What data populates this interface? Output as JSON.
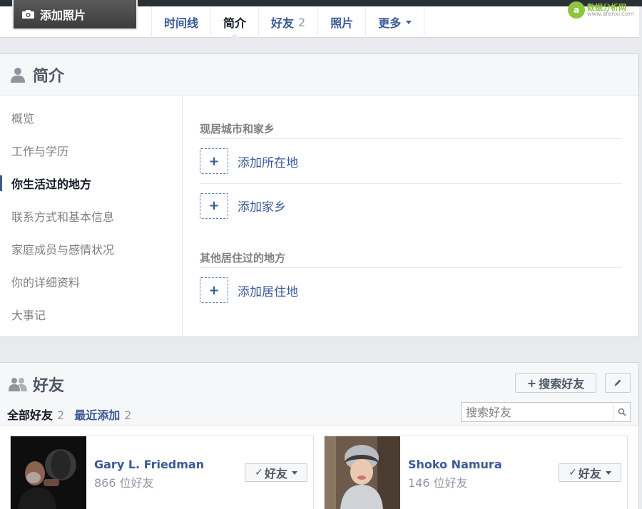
{
  "cover": {
    "add_photo_label": "添加照片"
  },
  "tabs": [
    {
      "label": "时间线",
      "count": ""
    },
    {
      "label": "简介",
      "count": ""
    },
    {
      "label": "好友",
      "count": "2"
    },
    {
      "label": "照片",
      "count": ""
    },
    {
      "label": "更多",
      "count": ""
    }
  ],
  "watermark": {
    "name": "数据分析网",
    "url": "www.afenxi.com"
  },
  "about": {
    "title": "简介",
    "nav": [
      {
        "label": "概览"
      },
      {
        "label": "工作与学历"
      },
      {
        "label": "你生活过的地方"
      },
      {
        "label": "联系方式和基本信息"
      },
      {
        "label": "家庭成员与感情状况"
      },
      {
        "label": "你的详细资料"
      },
      {
        "label": "大事记"
      }
    ],
    "selected_nav": "你生活过的地方",
    "sections": [
      {
        "title": "现居城市和家乡",
        "items": [
          "添加所在地",
          "添加家乡"
        ]
      },
      {
        "title": "其他居住过的地方",
        "items": [
          "添加居住地"
        ]
      }
    ]
  },
  "friends": {
    "title": "好友",
    "find_button": "搜索好友",
    "tabs": [
      {
        "label": "全部好友",
        "count": "2"
      },
      {
        "label": "最近添加",
        "count": "2"
      }
    ],
    "search_placeholder": "搜索好友",
    "list": [
      {
        "name": "Gary L. Friedman",
        "friend_count": "866 位好友",
        "button": "好友"
      },
      {
        "name": "Shoko Namura",
        "friend_count": "146 位好友",
        "button": "好友"
      }
    ]
  },
  "colors": {
    "link": "#3b5998",
    "muted": "#9197a3",
    "watermark_green": "#8dc63f"
  }
}
